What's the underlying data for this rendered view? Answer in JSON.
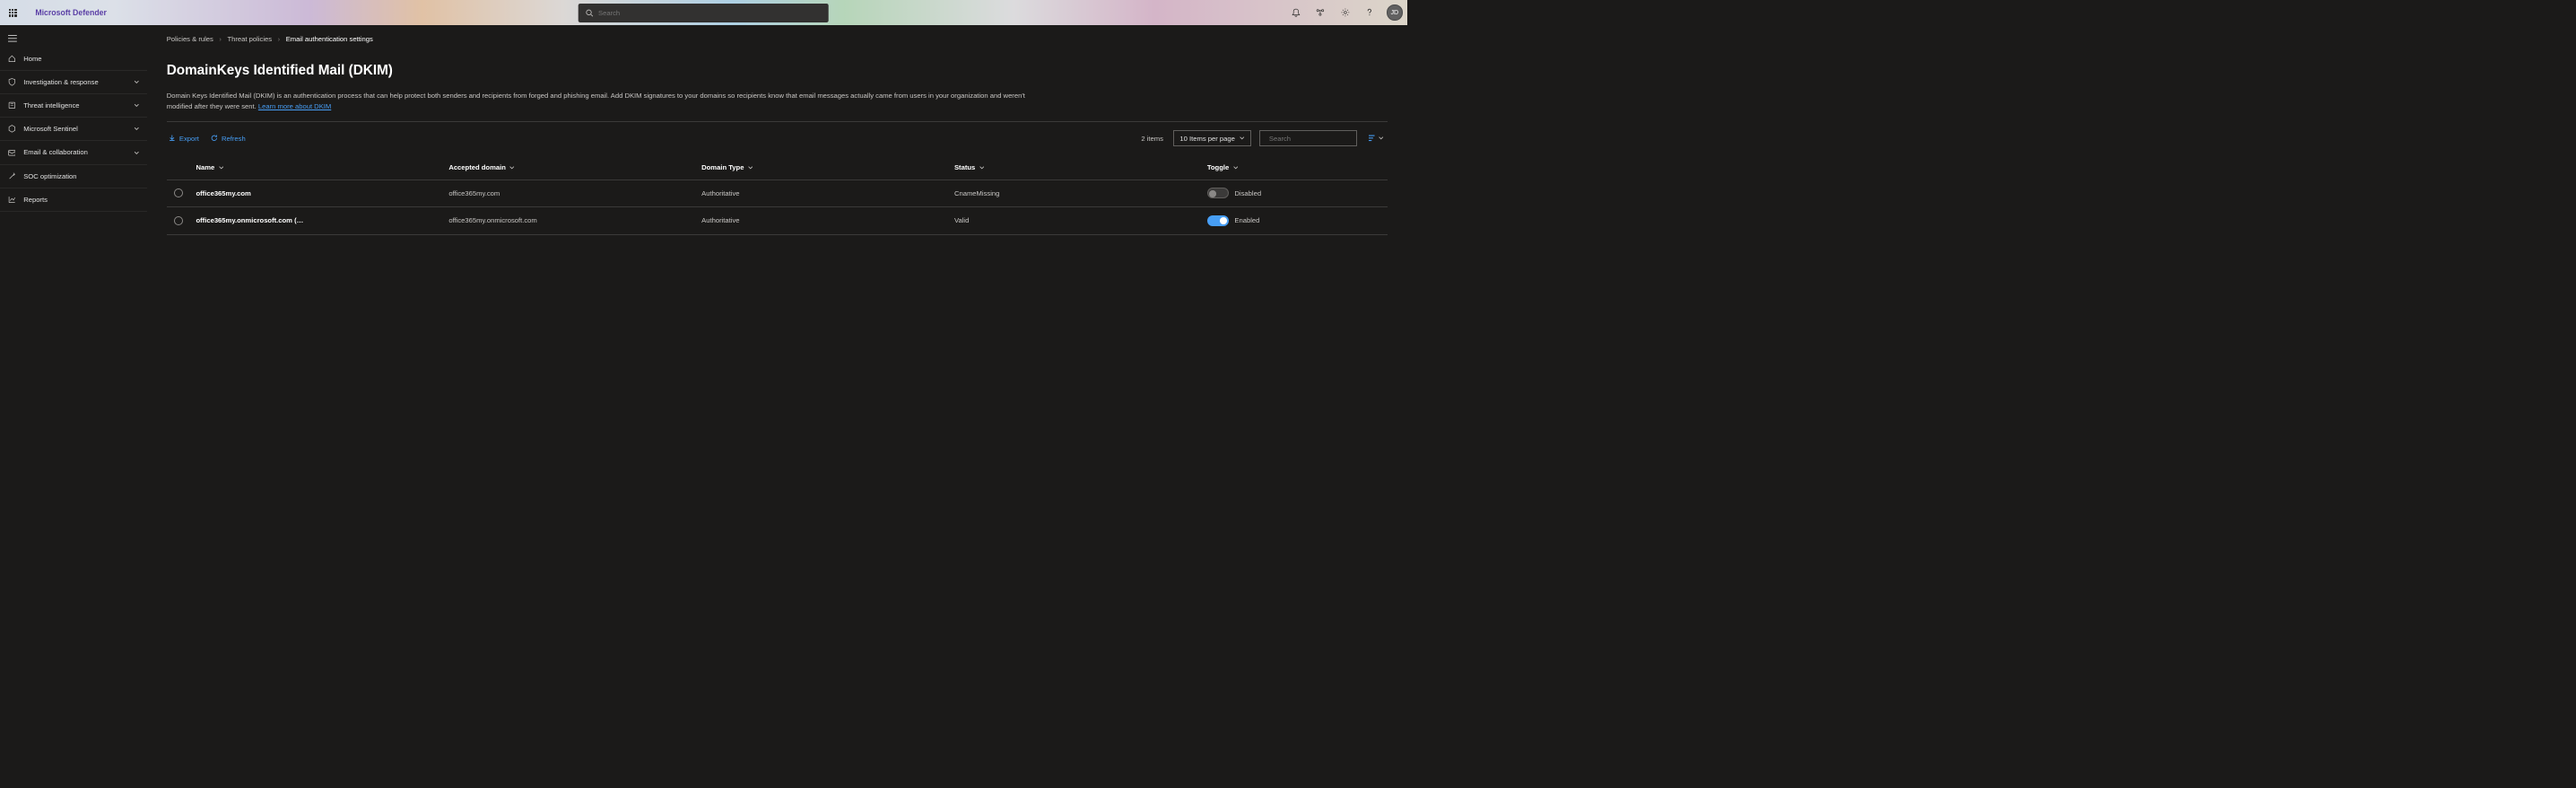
{
  "header": {
    "brand": "Microsoft Defender",
    "search_placeholder": "Search",
    "avatar_initials": "JD"
  },
  "sidebar": {
    "items": [
      {
        "label": "Home",
        "icon": "home",
        "expandable": false
      },
      {
        "label": "Investigation & response",
        "icon": "shield",
        "expandable": true
      },
      {
        "label": "Threat intelligence",
        "icon": "book",
        "expandable": true
      },
      {
        "label": "Microsoft Sentinel",
        "icon": "hex",
        "expandable": true
      },
      {
        "label": "Email & collaboration",
        "icon": "mail",
        "expandable": true
      },
      {
        "label": "SOC optimization",
        "icon": "wand",
        "expandable": false
      },
      {
        "label": "Reports",
        "icon": "chart",
        "expandable": false
      }
    ]
  },
  "breadcrumb": {
    "items": [
      "Policies & rules",
      "Threat policies"
    ],
    "current": "Email authentication settings"
  },
  "page": {
    "title": "DomainKeys Identified Mail (DKIM)",
    "description": "Domain Keys Identified Mail (DKIM) is an authentication process that can help protect both senders and recipients from forged and phishing email. Add DKIM signatures to your domains so recipients know that email messages actually came from users in your organization and weren't modified after they were sent. ",
    "learn_more": "Learn more about DKIM"
  },
  "toolbar": {
    "export": "Export",
    "refresh": "Refresh",
    "items_count": "2 items",
    "page_size": "10 Items per page",
    "search_placeholder": "Search"
  },
  "table": {
    "columns": [
      "Name",
      "Accepted domain",
      "Domain Type",
      "Status",
      "Toggle"
    ],
    "rows": [
      {
        "name": "office365my.com",
        "accepted": "office365my.com",
        "type": "Authoritative",
        "status": "CnameMissing",
        "enabled": false,
        "toggle_label": "Disabled"
      },
      {
        "name": "office365my.onmicrosoft.com (…",
        "accepted": "office365my.onmicrosoft.com",
        "type": "Authoritative",
        "status": "Valid",
        "enabled": true,
        "toggle_label": "Enabled"
      }
    ]
  }
}
